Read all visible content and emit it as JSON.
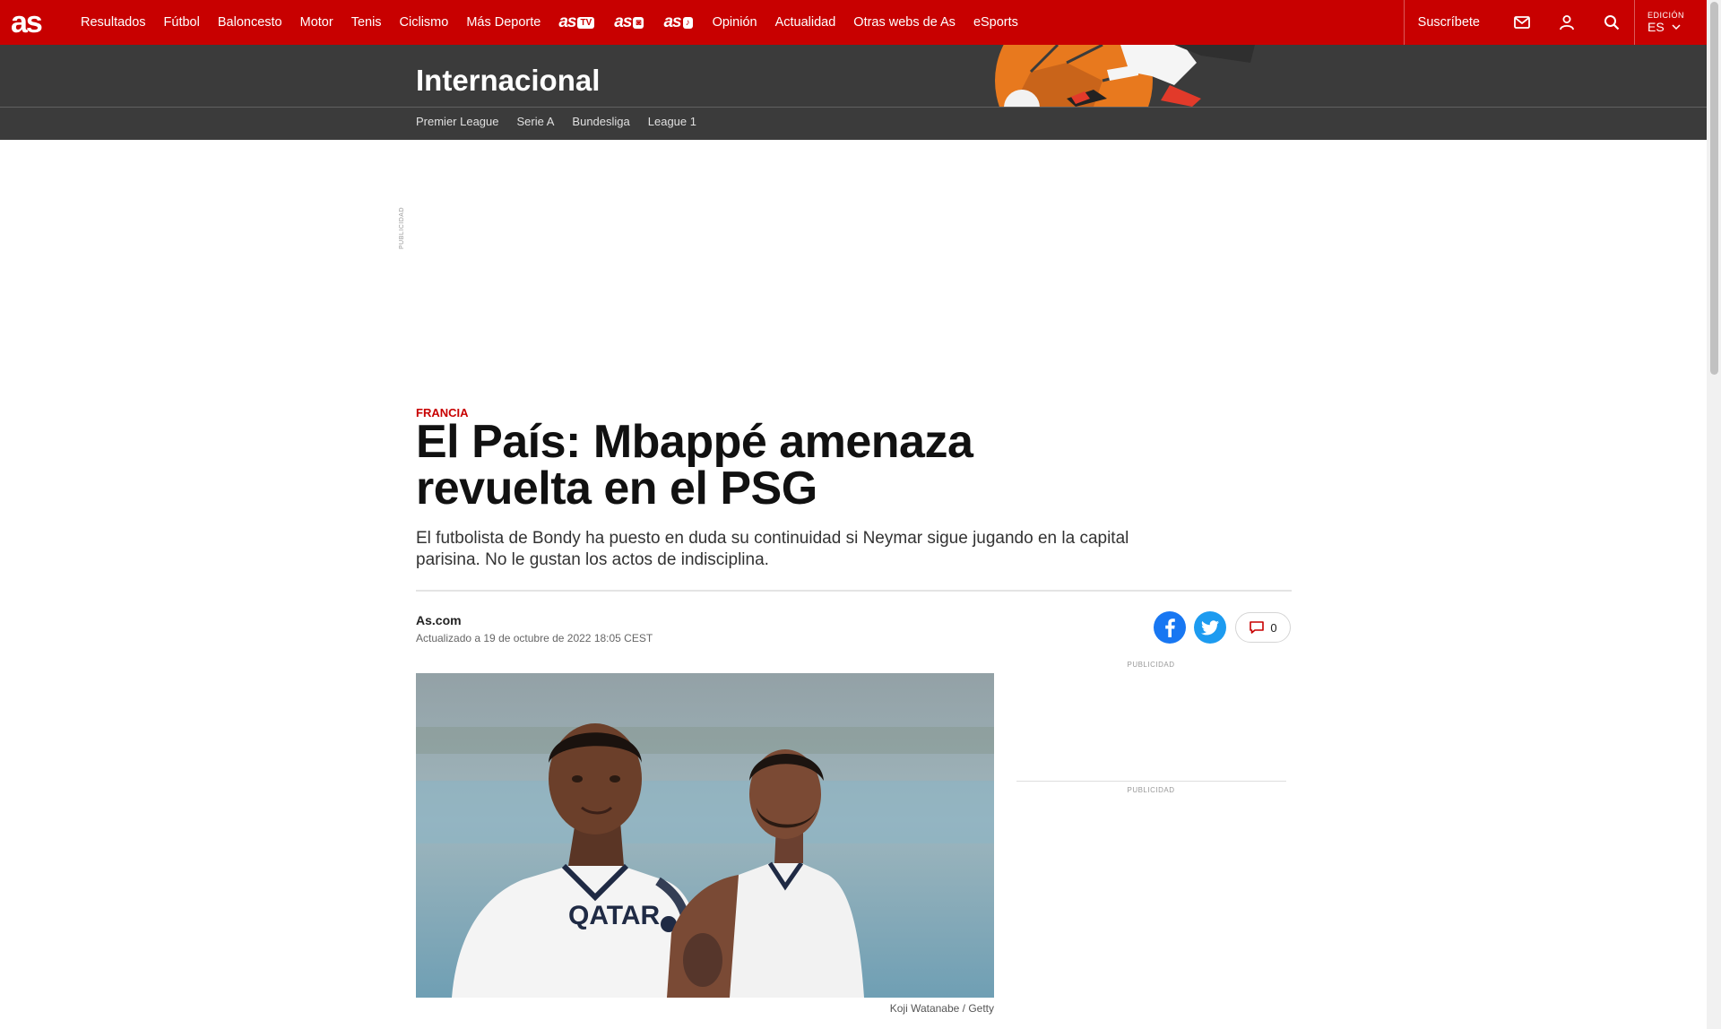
{
  "topnav": {
    "logo": "as",
    "links": [
      "Resultados",
      "Fútbol",
      "Baloncesto",
      "Motor",
      "Tenis",
      "Ciclismo",
      "Más Deporte"
    ],
    "brand_links": [
      {
        "text": "as",
        "badge": "TV"
      },
      {
        "text": "as",
        "badge": "◙"
      },
      {
        "text": "as",
        "badge": "♪"
      }
    ],
    "links2": [
      "Opinión",
      "Actualidad",
      "Otras webs de As",
      "eSports"
    ],
    "subscribe": "Suscríbete",
    "edition_label": "EDICIÓN",
    "edition_value": "ES",
    "icons": [
      "mail-icon",
      "user-icon",
      "search-icon",
      "chevron-down-icon"
    ]
  },
  "section": {
    "title": "Internacional",
    "subnav": [
      "Premier League",
      "Serie A",
      "Bundesliga",
      "League 1"
    ]
  },
  "ads": {
    "label_vertical": "PUBLICIDAD",
    "label_side_1": "PUBLICIDAD",
    "label_side_2": "PUBLICIDAD"
  },
  "article": {
    "kicker": "FRANCIA",
    "headline": "El País: Mbappé amenaza revuelta en el PSG",
    "standfirst": "El futbolista de Bondy ha puesto en duda su continuidad si Neymar sigue jugando en la capital parisina. No le gustan los actos de indisciplina.",
    "author": "As.com",
    "date": "Actualizado a 19 de octubre de 2022 18:05 CEST",
    "comments_count": "0",
    "photo_credit": "Koji Watanabe / Getty",
    "shirt_text": "QATAR"
  },
  "colors": {
    "brand": "#c80000",
    "section_bg": "#3b3b3b",
    "facebook": "#1877f2",
    "twitter": "#1d9bf0"
  }
}
